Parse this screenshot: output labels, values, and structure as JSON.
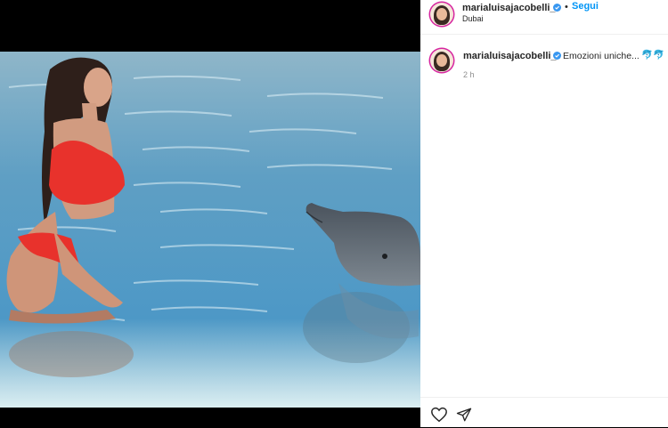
{
  "post": {
    "username": "marialuisajacobelli_",
    "follow_label": "Segui",
    "separator": "•",
    "location": "Dubai"
  },
  "caption": {
    "username": "marialuisajacobelli_",
    "text": "Emozioni uniche...",
    "emojis": "🐬🐬",
    "time": "2 h"
  },
  "icons": {
    "like": "heart-icon",
    "share": "paper-plane-icon",
    "verified": "verified-badge-icon"
  },
  "colors": {
    "accent": "#0095f6",
    "verified": "#3897f0",
    "text": "#262626",
    "muted": "#8e8e8e"
  }
}
